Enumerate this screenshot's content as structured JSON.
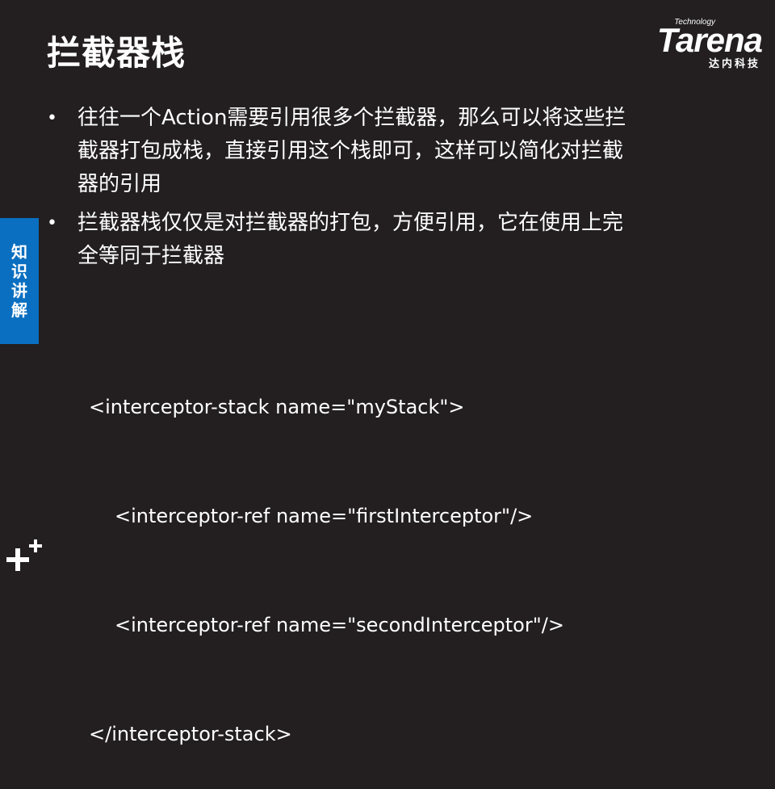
{
  "slide": {
    "title": "拦截器栈",
    "logo": {
      "technology": "Technology",
      "brand": "Tarena",
      "subtitle": "达内科技"
    },
    "side_tab": [
      "知",
      "识",
      "讲",
      "解"
    ],
    "bullets": [
      {
        "dot": "•",
        "lines": [
          "往往一个Action需要引用很多个拦截器，那么可以将这些拦",
          "截器打包成栈，直接引用这个栈即可，这样可以简化对拦截",
          "器的引用"
        ]
      },
      {
        "dot": "•",
        "lines": [
          "拦截器栈仅仅是对拦截器的打包，方便引用，它在使用上完",
          "全等同于拦截器"
        ]
      }
    ],
    "code_lines": [
      "<interceptor-stack name=\"myStack\">",
      "<interceptor-ref name=\"firstInterceptor\"/>",
      "<interceptor-ref name=\"secondInterceptor\"/>",
      "</interceptor-stack>"
    ],
    "colors": {
      "background": "#231f20",
      "side_tab": "#0a6fc0",
      "text": "#ffffff"
    },
    "corner_icon": "plus-plus-icon"
  }
}
